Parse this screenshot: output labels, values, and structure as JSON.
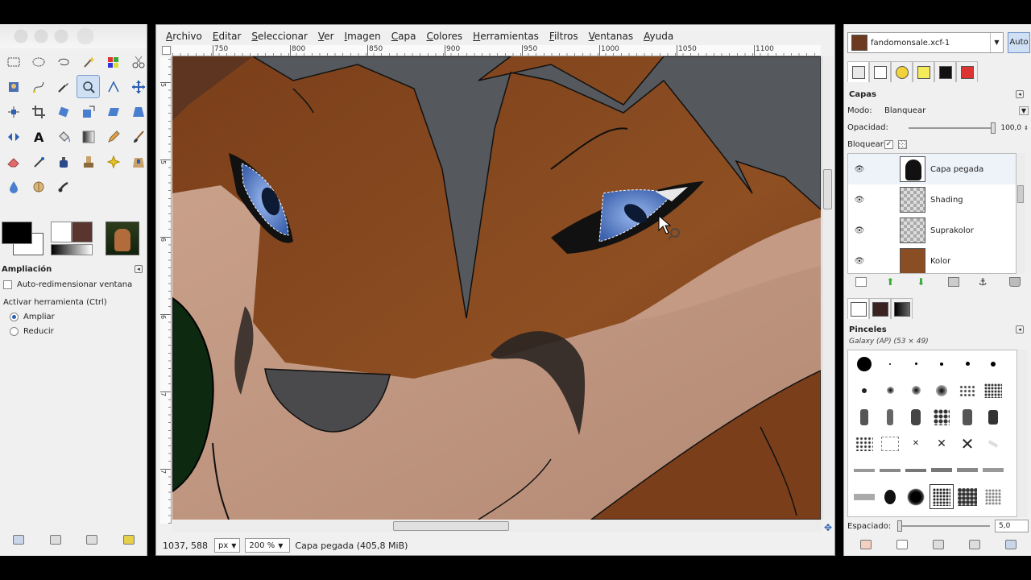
{
  "menu": [
    "Archivo",
    "Editar",
    "Seleccionar",
    "Ver",
    "Imagen",
    "Capa",
    "Colores",
    "Herramientas",
    "Filtros",
    "Ventanas",
    "Ayuda"
  ],
  "ruler_top": [
    "750",
    "800",
    "850",
    "900",
    "950",
    "1000",
    "1050",
    "1100"
  ],
  "ruler_left": [
    "5",
    "5",
    "6",
    "6",
    "7",
    "7"
  ],
  "tool_options": {
    "title": "Ampliación",
    "auto_resize": "Auto-redimensionar ventana",
    "activate": "Activar herramienta  (Ctrl)",
    "zoom_in": "Ampliar",
    "zoom_out": "Reducir"
  },
  "status": {
    "coords": "1037, 588",
    "unit": "px",
    "zoom": "200 %",
    "layer_info": "Capa pegada (405,8 MiB)"
  },
  "dock": {
    "image_name": "fandomonsale.xcf-1",
    "auto": "Auto",
    "layers_title": "Capas",
    "mode_label": "Modo:",
    "mode_value": "Blanquear",
    "opacity_label": "Opacidad:",
    "opacity_value": "100,0",
    "lock_label": "Bloquear:",
    "layers": [
      {
        "name": "Capa pegada"
      },
      {
        "name": "Shading"
      },
      {
        "name": "Suprakolor"
      },
      {
        "name": "Kolor"
      }
    ],
    "brushes_title": "Pinceles",
    "brush_name": "Galaxy (AP) (53 × 49)",
    "spacing_label": "Espaciado:",
    "spacing_value": "5,0"
  },
  "colors": {
    "accent": "#2b5fb3",
    "canvas_fur": "#8a4e24",
    "hair": "#55585c",
    "eye": "#5a82c8"
  },
  "icons": [
    "rect-select-icon",
    "ellipse-select-icon",
    "lasso-icon",
    "fuzzy-select-icon",
    "color-select-icon",
    "scissors-icon",
    "foreground-select-icon",
    "paths-icon",
    "color-picker-icon",
    "zoom-icon",
    "measure-icon",
    "move-icon",
    "align-icon",
    "crop-icon",
    "rotate-icon",
    "scale-icon",
    "shear-icon",
    "perspective-icon",
    "flip-icon",
    "text-icon",
    "bucket-fill-icon",
    "blend-icon",
    "pencil-icon",
    "paintbrush-icon",
    "eraser-icon",
    "airbrush-icon",
    "ink-icon",
    "clone-icon",
    "heal-icon",
    "perspective-clone-icon",
    "blur-icon",
    "dodge-burn-icon",
    "smudge-icon"
  ]
}
